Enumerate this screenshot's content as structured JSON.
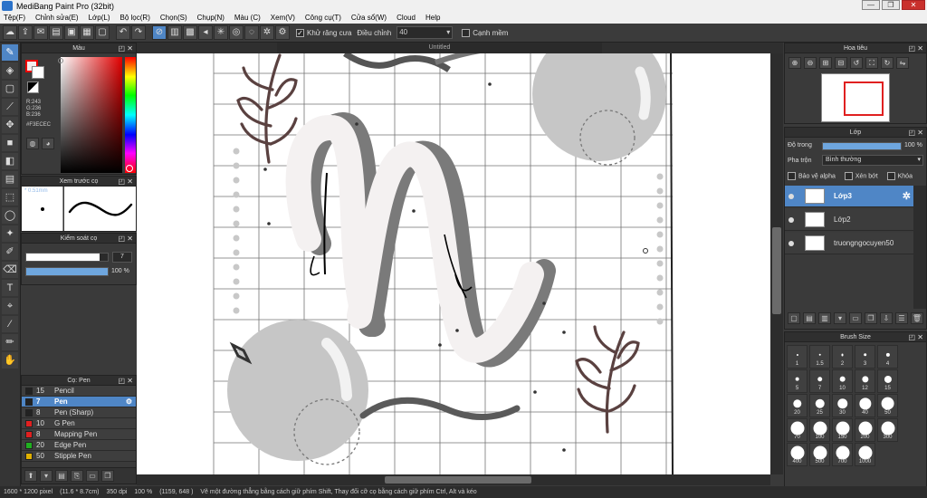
{
  "app_title": "MediBang Paint Pro (32bit)",
  "menu": [
    "Tệp(F)",
    "Chỉnh sửa(E)",
    "Lớp(L)",
    "Bộ lọc(R)",
    "Chọn(S)",
    "Chụp(N)",
    "Màu (C)",
    "Xem(V)",
    "Công cụ(T)",
    "Cửa sổ(W)",
    "Cloud",
    "Help"
  ],
  "toolbar": {
    "antialias_label": "Khử răng cưa",
    "stabilizer_label": "Điều chỉnh",
    "stabilizer_value": "40",
    "soften_label": "Cạnh mềm"
  },
  "color_panel": {
    "title": "Màu",
    "r": "R:243",
    "g": "G:236",
    "b": "B:236",
    "hex": "#F3ECEC",
    "fg_color": "#F3ECEC"
  },
  "brush_preview": {
    "title": "Xem trước cọ",
    "size": "* 0.51mm"
  },
  "brush_control": {
    "title": "Kiểm soát cọ",
    "size_value": "7",
    "size_fraction": 0.9,
    "opacity_value": "100 %",
    "opacity_fraction": 1.0
  },
  "brush_list": {
    "title": "Cọ: Pen",
    "items": [
      {
        "size": "15",
        "name": "Pencil",
        "color": "#222222",
        "selected": false
      },
      {
        "size": "7",
        "name": "Pen",
        "color": "#222222",
        "selected": true
      },
      {
        "size": "8",
        "name": "Pen (Sharp)",
        "color": "#222222",
        "selected": false
      },
      {
        "size": "10",
        "name": "G Pen",
        "color": "#e02020",
        "selected": false
      },
      {
        "size": "8",
        "name": "Mapping Pen",
        "color": "#e02020",
        "selected": false
      },
      {
        "size": "20",
        "name": "Edge Pen",
        "color": "#20b020",
        "selected": false
      },
      {
        "size": "50",
        "name": "Stipple Pen",
        "color": "#e0b000",
        "selected": false
      }
    ]
  },
  "document": {
    "tab": "Untitled"
  },
  "navigator": {
    "title": "Hoa tiêu"
  },
  "layers": {
    "title": "Lớp",
    "opacity_label": "Độ trong",
    "opacity_value": "100 %",
    "opacity_fraction": 1.0,
    "blend_label": "Pha trộn",
    "blend_value": "Bình thường",
    "protect_alpha": "Bảo vệ alpha",
    "clipping": "Xén bớt",
    "lock": "Khóa",
    "items": [
      {
        "name": "Lớp3",
        "selected": true
      },
      {
        "name": "Lớp2",
        "selected": false
      },
      {
        "name": "truongngocuyen50",
        "selected": false
      }
    ]
  },
  "brush_size": {
    "title": "Brush Size",
    "sizes": [
      "1",
      "1.5",
      "2",
      "3",
      "4",
      "5",
      "7",
      "10",
      "12",
      "15",
      "20",
      "25",
      "30",
      "40",
      "50",
      "70",
      "100",
      "150",
      "200",
      "300",
      "400",
      "500",
      "700",
      "1000"
    ]
  },
  "status": {
    "dims": "1600 * 1200 pixel",
    "phys": "(11.6 * 8.7cm)",
    "dpi": "350 dpi",
    "zoom": "100 %",
    "coords": "(1159, 648 )",
    "hint": "Vẽ một đường thẳng bằng cách giữ phím Shift, Thay đổi cỡ cọ bằng cách giữ phím Ctrl, Alt và kéo"
  }
}
